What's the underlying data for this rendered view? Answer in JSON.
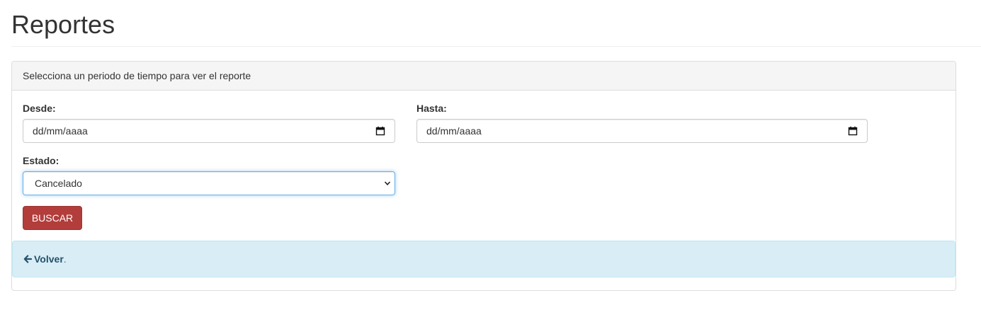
{
  "page": {
    "title": "Reportes"
  },
  "panel": {
    "heading": "Selecciona un periodo de tiempo para ver el reporte"
  },
  "form": {
    "desde_label": "Desde:",
    "desde_value": "dd/mm/aaaa",
    "hasta_label": "Hasta:",
    "hasta_value": "dd/mm/aaaa",
    "estado_label": "Estado:",
    "estado_selected": "Cancelado",
    "submit_label": "BUSCAR"
  },
  "alert": {
    "back_label": "Volver",
    "suffix": "."
  },
  "icons": {
    "calendar": "calendar-icon",
    "dropdown": "chevron-down-icon",
    "back": "arrow-left-icon"
  },
  "colors": {
    "button": "#b23d3b",
    "alert_bg": "#d9edf7",
    "alert_text": "#31708f",
    "focus_border": "#66afe9"
  }
}
